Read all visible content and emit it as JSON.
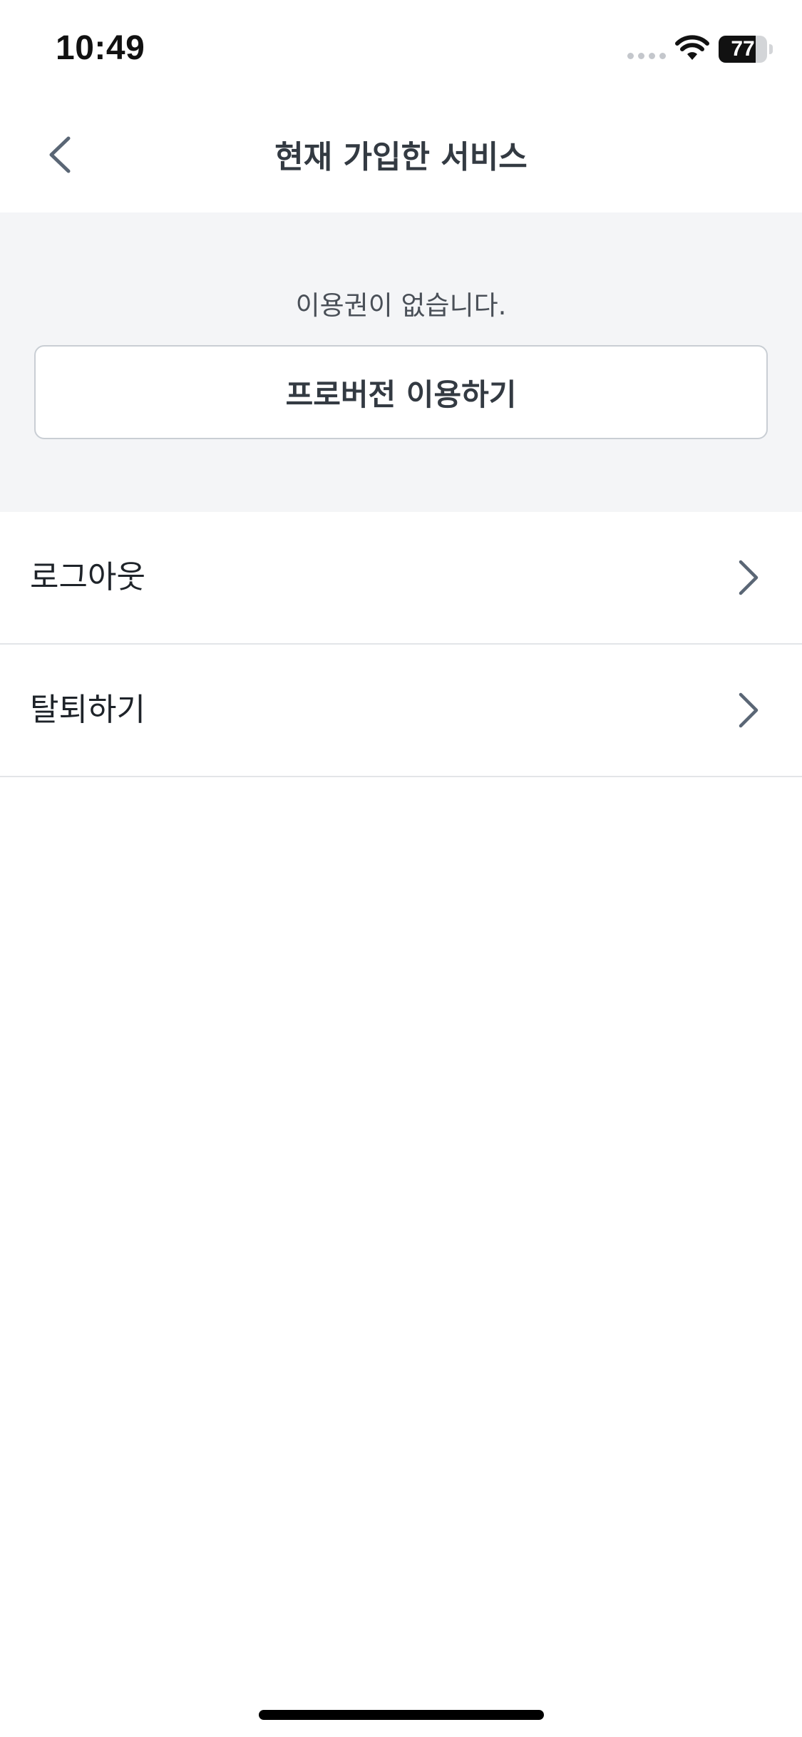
{
  "status_bar": {
    "time": "10:49",
    "battery_level": "77",
    "battery_fraction": 0.77
  },
  "header": {
    "title": "현재 가입한 서비스",
    "back_icon": "chevron-left-icon"
  },
  "subscription": {
    "empty_message": "이용권이 없습니다.",
    "pro_button_label": "프로버전 이용하기"
  },
  "menu": {
    "items": [
      {
        "label": "로그아웃",
        "icon": "chevron-right-icon"
      },
      {
        "label": "탈퇴하기",
        "icon": "chevron-right-icon"
      }
    ]
  },
  "colors": {
    "panel_background": "#f4f5f7",
    "title_text": "#333a42",
    "icon_stroke": "#5a6675",
    "divider": "#e3e5e8"
  }
}
